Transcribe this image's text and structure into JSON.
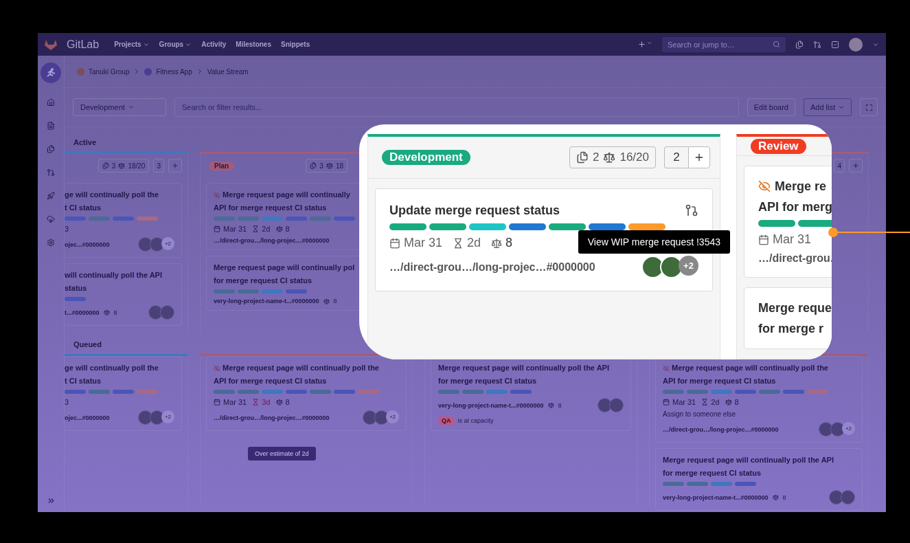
{
  "nav": {
    "brand": "GitLab",
    "links": [
      {
        "label": "Projects",
        "dropdown": true
      },
      {
        "label": "Groups",
        "dropdown": true
      },
      {
        "label": "Activity",
        "dropdown": false
      },
      {
        "label": "Milestones",
        "dropdown": false
      },
      {
        "label": "Snippets",
        "dropdown": false
      }
    ],
    "search_placeholder": "Search or jump to…"
  },
  "breadcrumb": [
    "Tanuki Group",
    "Fitness App",
    "Value Stream"
  ],
  "toolbar": {
    "board": "Development",
    "filter_placeholder": "Search or filter results...",
    "buttons": [
      {
        "label": "Edit board",
        "dropdown": false
      },
      {
        "label": "Add list",
        "dropdown": true
      }
    ]
  },
  "lanes": [
    {
      "title": "Active",
      "columns": [
        {
          "kind": "partial",
          "color": "#3d78c0",
          "issues": "3",
          "weight": "18/20",
          "limit": "3",
          "cards": [
            {
              "title_lines": [
                "ge will continually poll the",
                "t CI status"
              ],
              "wip": false,
              "labels": [
                {
                  "color": "#4a55b8"
                },
                {
                  "color": "#4a6a98"
                },
                {
                  "color": "#4a55b8"
                },
                {
                  "color": "#a56a86"
                }
              ],
              "meta_fragment": "3",
              "ref": "ojec...#0000000",
              "avatars": true,
              "more": "+2"
            },
            {
              "title_lines": [
                "will continually poll the API",
                "status"
              ],
              "wip": false,
              "labels": [
                {
                  "color": "#4a55b8"
                }
              ],
              "ref": "t...#0000000",
              "footer_weight": "8",
              "avatars": true
            }
          ]
        },
        {
          "kind": "full",
          "color": "#a35c7a",
          "pill": "Plan",
          "issues": "3",
          "weight": "18",
          "cards": [
            {
              "title_lines": [
                "Merge request page will continually",
                "API for merge request CI status"
              ],
              "wip": true,
              "labels": [
                {
                  "color": "#4a6a98"
                },
                {
                  "color": "#4a6a98"
                },
                {
                  "color": "#3d78c0"
                },
                {
                  "color": "#4a55b8"
                },
                {
                  "color": "#4a6a98"
                },
                {
                  "color": "#4a55b8"
                }
              ],
              "date": "Mar 31",
              "time": "2d",
              "time_over": false,
              "weight": "8",
              "ref": "…/direct-grou…/long-projec…#0000000"
            },
            {
              "title_lines": [
                "Merge request page will continually pol",
                "for merge request CI status"
              ],
              "wip": false,
              "labels": [
                {
                  "color": "#4a6a98"
                },
                {
                  "color": "#4a6a98"
                },
                {
                  "color": "#3d78c0"
                },
                {
                  "color": "#4a55b8"
                }
              ],
              "ref": "very-long-project-name-t...#0000000",
              "footer_weight": "8"
            }
          ]
        },
        {
          "kind": "hidden"
        },
        {
          "kind": "full",
          "color": "#a35c7a",
          "limit": "4"
        }
      ]
    },
    {
      "title": "Queued",
      "columns": [
        {
          "kind": "partial",
          "color": "#3d78c0",
          "cards": [
            {
              "title_lines": [
                "ge will continually poll the",
                "t CI status"
              ],
              "wip": false,
              "labels": [
                {
                  "color": "#4a55b8"
                },
                {
                  "color": "#4a6a98"
                },
                {
                  "color": "#4a55b8"
                },
                {
                  "color": "#a56a86"
                }
              ],
              "meta_fragment": "3",
              "ref": "ojec...#0000000",
              "avatars": true,
              "more": "+2"
            }
          ]
        },
        {
          "kind": "full",
          "color": "#a35c7a",
          "cards": [
            {
              "title_lines": [
                "Merge request page will continually poll the",
                "API for merge request CI status"
              ],
              "wip": true,
              "labels": [
                {
                  "color": "#4a6a98"
                },
                {
                  "color": "#4a6a98"
                },
                {
                  "color": "#3d78c0"
                },
                {
                  "color": "#4a55b8"
                },
                {
                  "color": "#4a6a98"
                },
                {
                  "color": "#4a55b8"
                },
                {
                  "color": "#a56a86"
                }
              ],
              "date": "Mar 31",
              "time": "3d",
              "time_over": true,
              "time_tooltip": "Over estimate of 2d",
              "weight": "8",
              "ref": "…/direct-grou…/long-projec…#0000000",
              "avatars": true,
              "more": "+2"
            }
          ]
        },
        {
          "kind": "full",
          "color": "#6a5aa0",
          "cards": [
            {
              "title_lines": [
                "Merge request page will continually poll the API",
                "for merge request CI status"
              ],
              "wip": false,
              "labels": [
                {
                  "color": "#4a6a98"
                },
                {
                  "color": "#4a6a98"
                },
                {
                  "color": "#3d78c0"
                },
                {
                  "color": "#4a55b8"
                }
              ],
              "ref": "very-long-project-name-t...#0000000",
              "footer_weight": "8",
              "avatars": true,
              "capacity": {
                "tag": "QA",
                "text": "is at capacity",
                "color": "#c2567e"
              }
            }
          ]
        },
        {
          "kind": "full",
          "color": "#a35c7a",
          "cards": [
            {
              "title_lines": [
                "Merge request page will continually poll the",
                "API for merge request CI status"
              ],
              "wip": true,
              "labels": [
                {
                  "color": "#4a6a98"
                },
                {
                  "color": "#4a6a98"
                },
                {
                  "color": "#3d78c0"
                },
                {
                  "color": "#4a55b8"
                },
                {
                  "color": "#4a6a98"
                },
                {
                  "color": "#4a55b8"
                },
                {
                  "color": "#a56a86"
                }
              ],
              "date": "Mar 31",
              "time": "2d",
              "time_over": false,
              "weight": "8",
              "note": "Assign to someone else",
              "ref": "…/direct-grou…/long-projec…#0000000",
              "avatars": true,
              "more": "+2"
            },
            {
              "title_lines": [
                "Merge request page will continually poll the API",
                "for merge request CI status"
              ],
              "wip": false,
              "labels": [
                {
                  "color": "#4a6a98"
                },
                {
                  "color": "#4a6a98"
                },
                {
                  "color": "#3d78c0"
                },
                {
                  "color": "#4a55b8"
                }
              ],
              "ref": "very-long-project-name-t...#0000000",
              "footer_weight": "8",
              "avatars": true
            }
          ]
        }
      ]
    }
  ],
  "callout": {
    "columns": [
      {
        "pill": "Development",
        "color": "#1aaa80",
        "issues": "2",
        "weight": "16/20",
        "limit": "2",
        "cards": [
          {
            "title_lines": [
              "Update merge request status"
            ],
            "mr_icon": true,
            "wip": false,
            "labels": [
              {
                "color": "#1aaa80"
              },
              {
                "color": "#1aaa80"
              },
              {
                "color": "#1ec5c5"
              },
              {
                "color": "#1f78d1"
              },
              {
                "color": "#1aaa80"
              },
              {
                "color": "#1f78d1"
              },
              {
                "color": "#fc9a2b"
              }
            ],
            "date": "Mar 31",
            "time": "2d",
            "time_over": false,
            "weight": "8",
            "ref": "…/direct-grou…/long-projec…#0000000",
            "avatars": true,
            "more": "+2",
            "tooltip": "View WIP merge request !3543"
          }
        ]
      },
      {
        "pill": "Review",
        "color": "#f03c23",
        "cards": [
          {
            "title_lines": [
              "Merge re",
              "API for merg"
            ],
            "wip": true,
            "labels": [
              {
                "color": "#1aaa80"
              },
              {
                "color": "#1aaa80"
              }
            ],
            "date": "Mar 31",
            "ref": "…/direct-grou."
          },
          {
            "title_lines": [
              "Merge reque",
              "for merge r"
            ],
            "wip": false
          }
        ]
      }
    ]
  }
}
